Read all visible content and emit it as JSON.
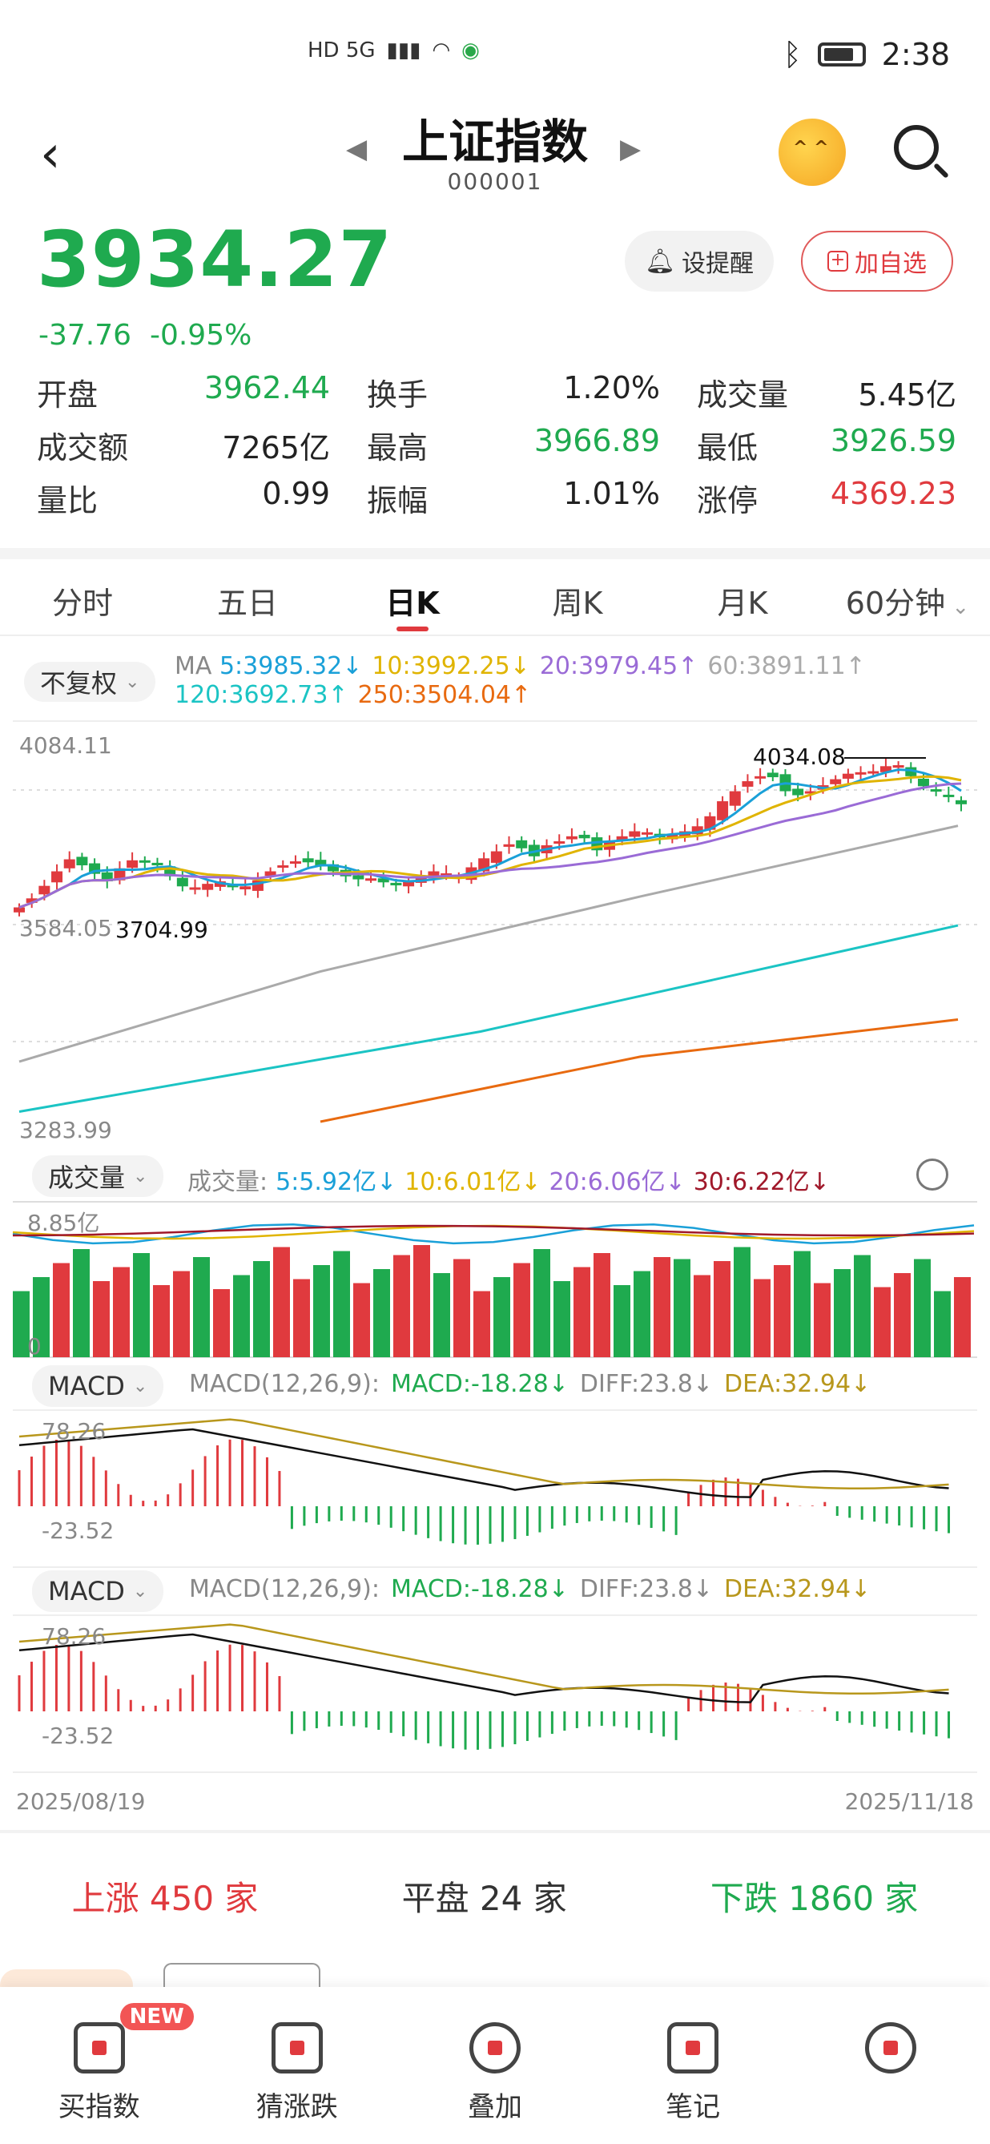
{
  "status_bar": {
    "network": "HD 5G",
    "time": "2:38"
  },
  "header": {
    "title": "上证指数",
    "code": "000001"
  },
  "quote": {
    "price": "3934.27",
    "change": "-37.76",
    "change_pct": "-0.95%",
    "remind_label": "设提醒",
    "add_label": "加自选"
  },
  "stats": [
    [
      {
        "label": "开盘",
        "value": "3962.44",
        "color": "green"
      },
      {
        "label": "换手",
        "value": "1.20%",
        "color": "dark"
      },
      {
        "label": "成交量",
        "value": "5.45亿",
        "color": "dark"
      }
    ],
    [
      {
        "label": "成交额",
        "value": "7265亿",
        "color": "dark"
      },
      {
        "label": "最高",
        "value": "3966.89",
        "color": "green"
      },
      {
        "label": "最低",
        "value": "3926.59",
        "color": "green"
      }
    ],
    [
      {
        "label": "量比",
        "value": "0.99",
        "color": "dark"
      },
      {
        "label": "振幅",
        "value": "1.01%",
        "color": "dark"
      },
      {
        "label": "涨停",
        "value": "4369.23",
        "color": "red"
      }
    ]
  ],
  "tabs": [
    "分时",
    "五日",
    "日K",
    "周K",
    "月K",
    "60分钟"
  ],
  "active_tab": 2,
  "kline": {
    "adjust_label": "不复权",
    "ma_prefix": "MA",
    "ma": [
      {
        "text": "5:3985.32↓",
        "color": "#1aa0d8"
      },
      {
        "text": "10:3992.25↓",
        "color": "#e0b400"
      },
      {
        "text": "20:3979.45↑",
        "color": "#9a6bd6"
      },
      {
        "text": "60:3891.11↑",
        "color": "#aaaaaa"
      },
      {
        "text": "120:3692.73↑",
        "color": "#1bc4c4"
      },
      {
        "text": "250:3504.04↑",
        "color": "#e86a10"
      }
    ],
    "y_top": "4084.11",
    "y_mid": "3584.05",
    "y_bottom": "3283.99",
    "high_annotation": "4034.08",
    "low_annotation": "3704.99"
  },
  "volume": {
    "label": "成交量",
    "prefix": "成交量:",
    "ma": [
      {
        "text": "5:5.92亿↓",
        "color": "#1aa0d8"
      },
      {
        "text": "10:6.01亿↓",
        "color": "#e0b400"
      },
      {
        "text": "20:6.06亿↓",
        "color": "#9a6bd6"
      },
      {
        "text": "30:6.22亿↓",
        "color": "#a0182a"
      }
    ],
    "y_top": "8.85亿",
    "y_zero": "0"
  },
  "macd_panels": [
    {
      "label": "MACD",
      "params": "MACD(12,26,9):",
      "macd": "MACD:-18.28↓",
      "diff": "DIFF:23.8↓",
      "dea": "DEA:32.94↓",
      "y_top": "78.26",
      "y_bottom": "-23.52"
    },
    {
      "label": "MACD",
      "params": "MACD(12,26,9):",
      "macd": "MACD:-18.28↓",
      "diff": "DIFF:23.8↓",
      "dea": "DEA:32.94↓",
      "y_top": "78.26",
      "y_bottom": "-23.52"
    }
  ],
  "dates": {
    "start": "2025/08/19",
    "end": "2025/11/18"
  },
  "breadth": {
    "up": "上涨 450 家",
    "flat": "平盘 24 家",
    "down": "下跌 1860 家"
  },
  "nav": [
    {
      "label": "买指数",
      "badge": "NEW"
    },
    {
      "label": "猜涨跌"
    },
    {
      "label": "叠加"
    },
    {
      "label": "笔记"
    },
    {
      "label": ""
    }
  ],
  "colors": {
    "up": "#e03a3e",
    "down": "#1faa4f"
  }
}
